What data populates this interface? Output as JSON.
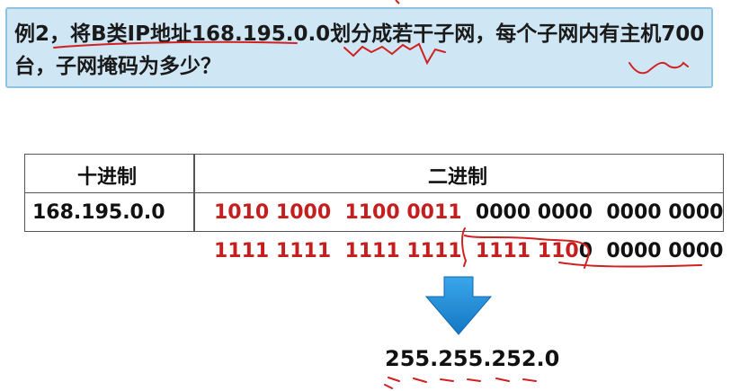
{
  "question": {
    "line1": "例2，将B类IP地址168.195.0.0划分成若干子网，每个子网内有主机700",
    "line2": "台，子网掩码为多少？"
  },
  "table": {
    "headers": [
      "十进制",
      "二进制"
    ],
    "row": {
      "decimal": "168.195.0.0",
      "binary_red": "1010 1000  1100 0011",
      "binary_black": "0000 0000  0000 0000"
    }
  },
  "mask_binary": {
    "red": "1111 1111  1111 1111  1111 110",
    "black": "0  0000 0000"
  },
  "result": "255.255.252.0",
  "colors": {
    "question_bg": "#cfe6f4",
    "question_border": "#8fc1e0",
    "highlight_red": "#c41e1e",
    "arrow_blue": "#1e8fdc",
    "annotation_red": "#d12020"
  }
}
